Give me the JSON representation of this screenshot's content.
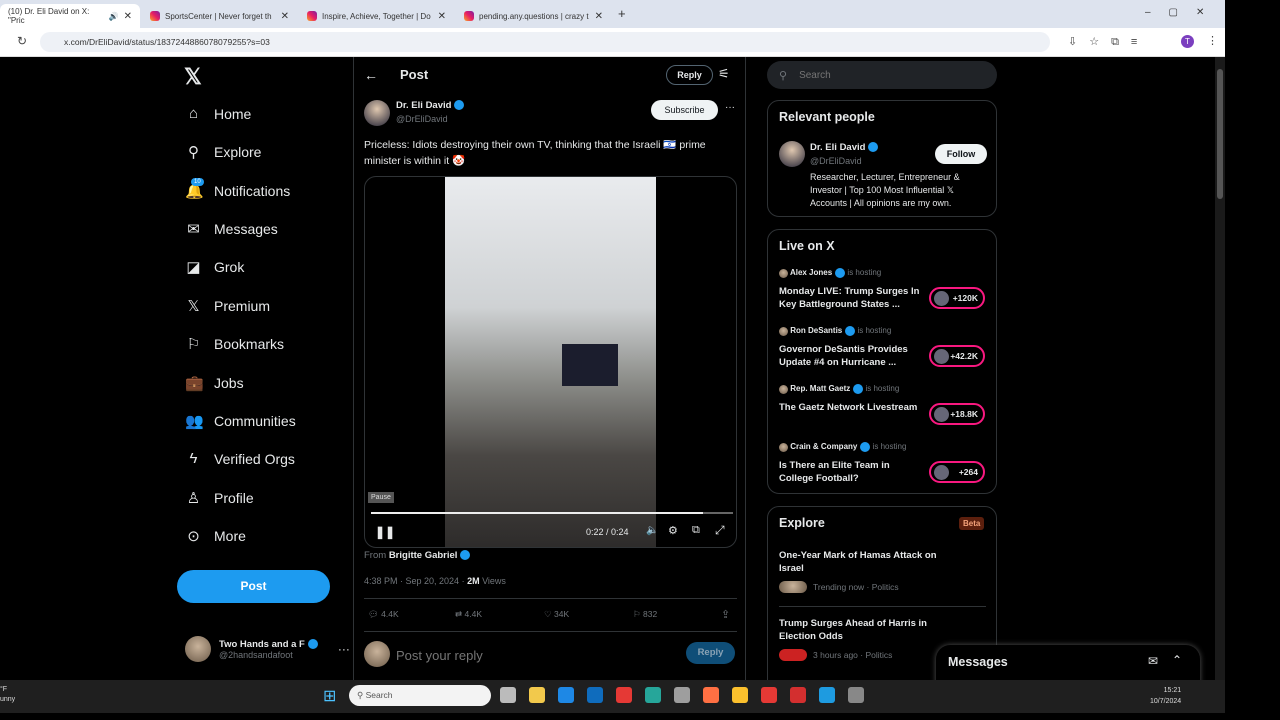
{
  "browser": {
    "tabs": [
      {
        "title": "(10) Dr. Eli David on X: \"Pric",
        "active": true
      },
      {
        "title": "SportsCenter | Never forget th"
      },
      {
        "title": "Inspire, Achieve, Together | Do"
      },
      {
        "title": "pending.any.questions | crazy t"
      }
    ],
    "new_tab": "+",
    "url": "x.com/DrEliDavid/status/1837244886078079255?s=03",
    "profile_initial": "T"
  },
  "sidebar": {
    "items": [
      {
        "label": "Home",
        "icon": "home-icon",
        "glyph": "⌂"
      },
      {
        "label": "Explore",
        "icon": "search-icon",
        "glyph": "⚲"
      },
      {
        "label": "Notifications",
        "icon": "bell-icon",
        "glyph": "🔔",
        "badge": "10"
      },
      {
        "label": "Messages",
        "icon": "mail-icon",
        "glyph": "✉"
      },
      {
        "label": "Grok",
        "icon": "grok-icon",
        "glyph": "◪"
      },
      {
        "label": "Premium",
        "icon": "x-logo-icon",
        "glyph": "𝕏"
      },
      {
        "label": "Bookmarks",
        "icon": "bookmark-icon",
        "glyph": "⚐"
      },
      {
        "label": "Jobs",
        "icon": "briefcase-icon",
        "glyph": "💼"
      },
      {
        "label": "Communities",
        "icon": "people-icon",
        "glyph": "👥"
      },
      {
        "label": "Verified Orgs",
        "icon": "lightning-icon",
        "glyph": "ϟ"
      },
      {
        "label": "Profile",
        "icon": "person-icon",
        "glyph": "♙"
      },
      {
        "label": "More",
        "icon": "more-circle-icon",
        "glyph": "⊙"
      }
    ],
    "post_label": "Post",
    "account": {
      "name": "Two Hands and a F",
      "handle": "@2handsandafoot"
    }
  },
  "main": {
    "header": {
      "title": "Post",
      "reply_label": "Reply"
    },
    "tweet": {
      "author": "Dr. Eli David",
      "handle": "@DrEliDavid",
      "subscribe_label": "Subscribe",
      "text": "Priceless: Idiots destroying their own TV, thinking that the Israeli 🇮🇱 prime minister is within it 🤡",
      "video": {
        "tooltip": "Pause",
        "time": "0:22 / 0:24",
        "progress": 0.917
      },
      "from_prefix": "From",
      "from_name": "Brigitte Gabriel",
      "timestamp": "4:38 PM · Sep 20, 2024 · ",
      "views_count": "2M",
      "views_label": " Views",
      "stats": {
        "replies": "4.4K",
        "reposts": "4.4K",
        "likes": "34K",
        "bookmarks": "832"
      }
    },
    "reply_box": {
      "placeholder": "Post your reply",
      "button": "Reply"
    }
  },
  "right": {
    "search_placeholder": "Search",
    "relevant": {
      "title": "Relevant people",
      "name": "Dr. Eli David",
      "handle": "@DrEliDavid",
      "follow": "Follow",
      "bio": "Researcher, Lecturer, Entrepreneur & Investor | Top 100 Most Influential 𝕏 Accounts | All opinions are my own."
    },
    "live": {
      "title": "Live on X",
      "hosting": "is hosting",
      "items": [
        {
          "host": "Alex Jones",
          "title": "Monday LIVE: Trump Surges In Key Battleground States ...",
          "count": "+120K"
        },
        {
          "host": "Ron DeSantis",
          "title": "Governor DeSantis Provides Update #4 on Hurricane ...",
          "count": "+42.2K"
        },
        {
          "host": "Rep. Matt Gaetz",
          "title": "The Gaetz Network Livestream",
          "count": "+18.8K"
        },
        {
          "host": "Crain & Company",
          "title": "Is There an Elite Team in College Football?",
          "count": "+264"
        }
      ]
    },
    "explore": {
      "title": "Explore",
      "badge": "Beta",
      "items": [
        {
          "title": "One-Year Mark of Hamas Attack on Israel",
          "meta": "Trending now · Politics"
        },
        {
          "title": "Trump Surges Ahead of Harris in Election Odds",
          "meta": "3 hours ago · Politics"
        }
      ]
    },
    "messages_title": "Messages"
  },
  "taskbar": {
    "weather": [
      "°F",
      "unny"
    ],
    "search_placeholder": "Search",
    "time": "15:21",
    "date": "10/7/2024"
  },
  "colors": {
    "accent": "#1d9bf0",
    "live": "#f91880",
    "beta_bg": "#5c1f0d"
  }
}
